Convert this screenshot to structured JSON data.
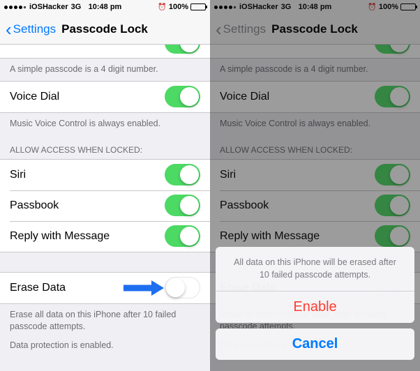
{
  "status": {
    "carrier": "iOSHacker",
    "network": "3G",
    "time": "10:48 pm",
    "battery": "100%"
  },
  "nav": {
    "back": "Settings",
    "title": "Passcode Lock"
  },
  "notes": {
    "simple": "A simple passcode is a 4 digit number.",
    "voice": "Music Voice Control is always enabled.",
    "erase": "Erase all data on this iPhone after 10 failed passcode attempts.",
    "protection": "Data protection is enabled."
  },
  "headers": {
    "allow": "ALLOW ACCESS WHEN LOCKED:"
  },
  "cells": {
    "voiceDial": "Voice Dial",
    "siri": "Siri",
    "passbook": "Passbook",
    "reply": "Reply with Message",
    "erase": "Erase Data"
  },
  "sheet": {
    "message": "All data on this iPhone will be erased after 10 failed passcode attempts.",
    "enable": "Enable",
    "cancel": "Cancel"
  },
  "colors": {
    "accent": "#007aff",
    "toggleOn": "#4cd964",
    "destructive": "#ff3b30",
    "arrow": "#1e6ef0"
  }
}
